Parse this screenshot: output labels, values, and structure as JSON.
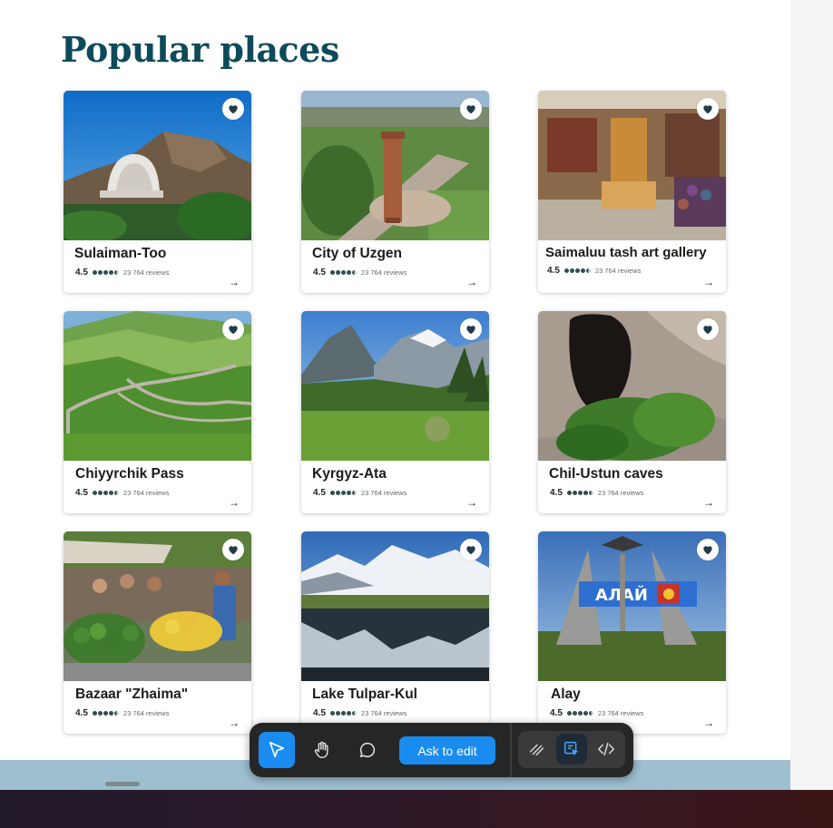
{
  "page": {
    "title": "Popular places"
  },
  "places": [
    {
      "name": "Sulaiman-Too",
      "rating": "4.5",
      "stars": 4.5,
      "reviews": "23 764 reviews",
      "arrow": "→"
    },
    {
      "name": "City of Uzgen",
      "rating": "4.5",
      "stars": 4.5,
      "reviews": "23 764 reviews",
      "arrow": "→"
    },
    {
      "name": "Saimaluu tash art gallery",
      "rating": "4.5",
      "stars": 4.5,
      "reviews": "23 764 reviews",
      "arrow": "→"
    },
    {
      "name": "Chiyyrchik Pass",
      "rating": "4.5",
      "stars": 4.5,
      "reviews": "23 764 reviews",
      "arrow": "→"
    },
    {
      "name": "Kyrgyz-Ata",
      "rating": "4.5",
      "stars": 4.5,
      "reviews": "23 764 reviews",
      "arrow": "→"
    },
    {
      "name": "Chil-Ustun caves",
      "rating": "4.5",
      "stars": 4.5,
      "reviews": "23 764 reviews",
      "arrow": "→"
    },
    {
      "name": "Bazaar \"Zhaima\"",
      "rating": "4.5",
      "stars": 4.5,
      "reviews": "23 764 reviews",
      "arrow": "→"
    },
    {
      "name": "Lake Tulpar-Kul",
      "rating": "4.5",
      "stars": 4.5,
      "reviews": "23 764 reviews",
      "arrow": "→"
    },
    {
      "name": "Alay",
      "rating": "4.5",
      "stars": 4.5,
      "reviews": "23 764 reviews",
      "arrow": "→"
    }
  ],
  "photo_signs": {
    "alay": "АЛАЙ"
  },
  "toolbar": {
    "tools": [
      "pointer-icon",
      "hand-icon",
      "comment-icon"
    ],
    "ask_label": "Ask to edit",
    "right_tools": [
      "draw-icon",
      "select-element-icon",
      "code-icon"
    ],
    "active_tool": "pointer-icon",
    "accent": "#1a8cf0"
  },
  "colors": {
    "title": "#0d4a5a",
    "footer_band": "#9dbfcf"
  }
}
